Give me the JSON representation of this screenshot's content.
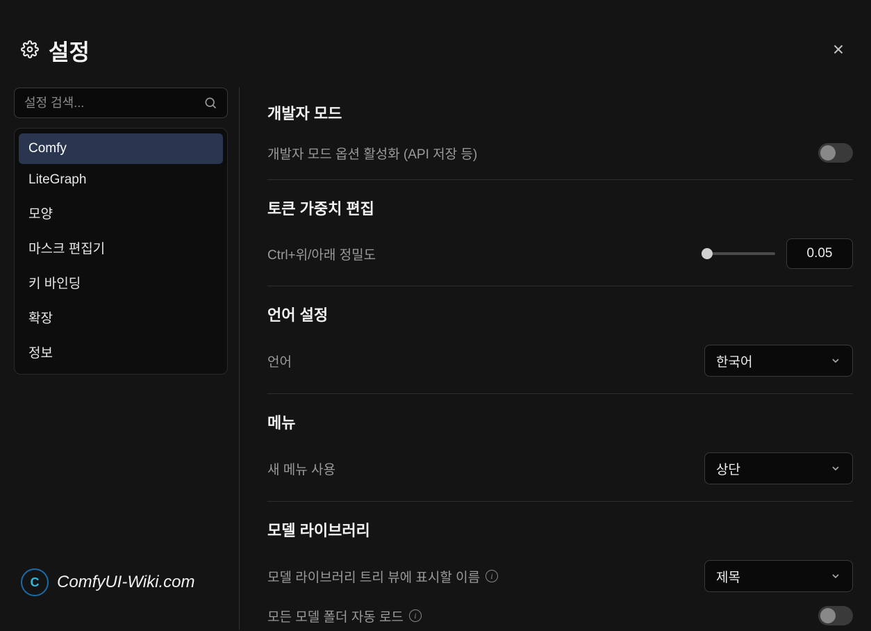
{
  "title": "설정",
  "search_placeholder": "설정 검색...",
  "sidebar": {
    "items": [
      {
        "label": "Comfy",
        "active": true
      },
      {
        "label": "LiteGraph",
        "active": false
      },
      {
        "label": "모양",
        "active": false
      },
      {
        "label": "마스크 편집기",
        "active": false
      },
      {
        "label": "키 바인딩",
        "active": false
      },
      {
        "label": "확장",
        "active": false
      },
      {
        "label": "정보",
        "active": false
      }
    ]
  },
  "sections": {
    "dev_mode": {
      "title": "개발자 모드",
      "option_label": "개발자 모드 옵션 활성화 (API 저장 등)",
      "enabled": false
    },
    "token_weight": {
      "title": "토큰 가중치 편집",
      "precision_label": "Ctrl+위/아래 정밀도",
      "precision_value": "0.05"
    },
    "language": {
      "title": "언어 설정",
      "label": "언어",
      "value": "한국어"
    },
    "menu": {
      "title": "메뉴",
      "label": "새 메뉴 사용",
      "value": "상단"
    },
    "model_library": {
      "title": "모델 라이브러리",
      "tree_name_label": "모델 라이브러리 트리 뷰에 표시할 이름",
      "tree_name_value": "제목",
      "autoload_label": "모든 모델 폴더 자동 로드",
      "autoload_enabled": false
    }
  },
  "watermark": "ComfyUI-Wiki.com"
}
